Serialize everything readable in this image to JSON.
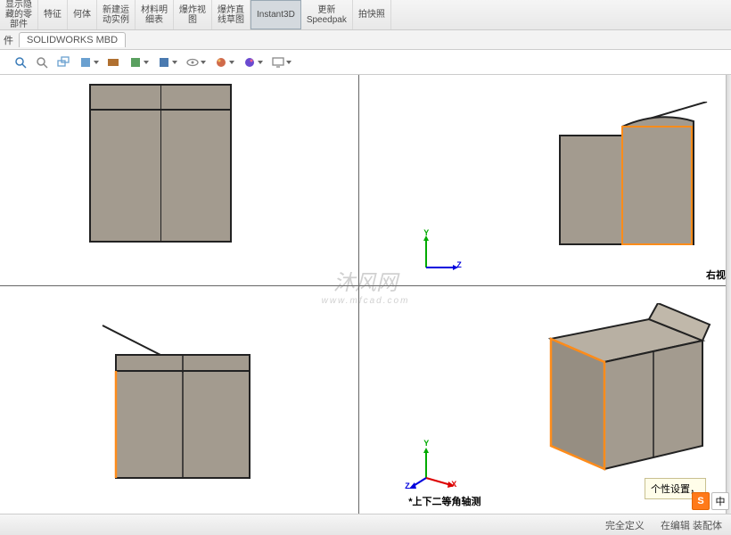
{
  "ribbon": {
    "groups": [
      {
        "label": "显示隐\n藏的零\n部件"
      },
      {
        "label": "特征"
      },
      {
        "label": "何体"
      },
      {
        "label": "新建运\n动实例"
      },
      {
        "label": "材料明\n细表"
      },
      {
        "label": "爆炸视\n图"
      },
      {
        "label": "爆炸直\n线草图"
      },
      {
        "label": "Instant3D",
        "active": true
      },
      {
        "label": "更新\nSpeedpak"
      },
      {
        "label": "拍快照"
      }
    ]
  },
  "tabs": {
    "prefix": "件",
    "active": "SOLIDWORKS MBD"
  },
  "tools": [
    "zoom-fit-icon",
    "magnify-icon",
    "zoom-area-icon",
    "rotate-icon",
    "section-icon",
    "display-style-icon",
    "render-icon",
    "hide-icon",
    "scene-icon",
    "appearance-icon",
    "screen-icon"
  ],
  "views": {
    "top_right_label": "右视",
    "bottom_right_label": "*上下二等角轴测"
  },
  "triad": {
    "x": "X",
    "y": "Y",
    "z": "Z"
  },
  "watermark": {
    "main": "沐风网",
    "sub": "www.mfcad.com"
  },
  "tooltip": "个性设置，",
  "status": {
    "define": "完全定义",
    "mode": "在编辑 装配体"
  },
  "ime": {
    "a": "S",
    "b": "中",
    "c": "•"
  },
  "colors": {
    "model": "#a39b8f",
    "edge": "#ff8c1a"
  }
}
